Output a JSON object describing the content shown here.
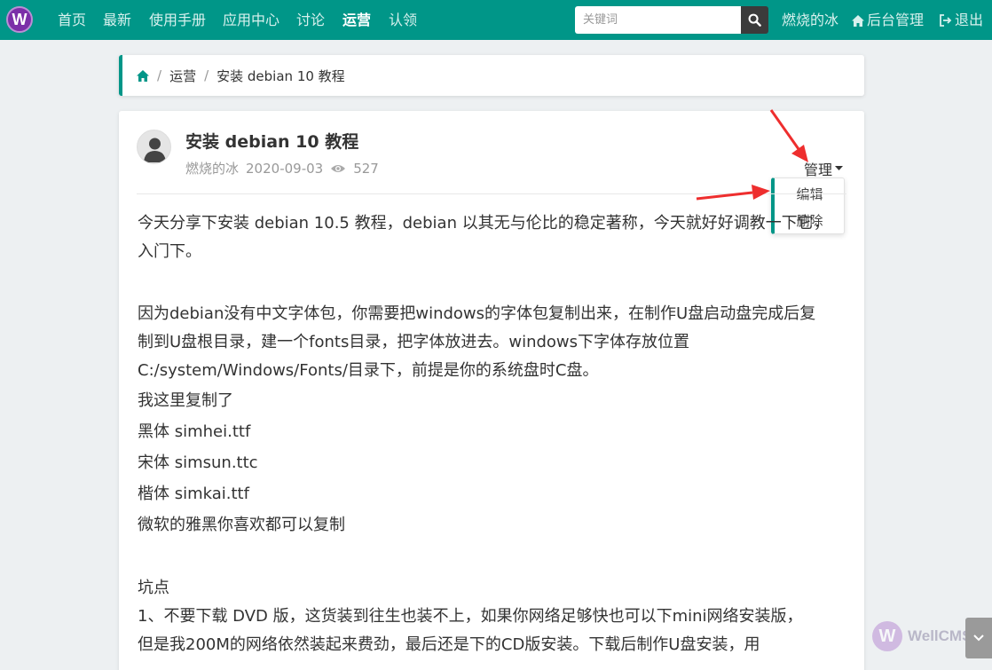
{
  "nav": {
    "logo": "W",
    "items": [
      "首页",
      "最新",
      "使用手册",
      "应用中心",
      "讨论",
      "运营",
      "认领"
    ],
    "active_index": 5,
    "search_placeholder": "关键词",
    "user": "燃烧的冰",
    "admin": "后台管理",
    "logout": "退出"
  },
  "breadcrumb": {
    "section": "运营",
    "current": "安装 debian 10 教程",
    "separator": "/"
  },
  "post": {
    "title": "安装 debian 10 教程",
    "author": "燃烧的冰",
    "date": "2020-09-03",
    "views": "527",
    "manage_label": "管理",
    "menu": [
      "编辑",
      "删除"
    ],
    "paragraphs": {
      "p1": "今天分享下安装 debian 10.5 教程，debian 以其无与伦比的稳定著称，今天就好好调教一下它，",
      "p1b": "入门下。",
      "p2": "因为debian没有中文字体包，你需要把windows的字体包复制出来，在制作U盘启动盘完成后复",
      "p2b": "制到U盘根目录，建一个fonts目录，把字体放进去。windows下字体存放位置",
      "p2c": "C:/system/Windows/Fonts/目录下，前提是你的系统盘时C盘。",
      "p3": "我这里复制了",
      "p4": "黑体 simhei.ttf",
      "p5": "宋体 simsun.ttc",
      "p6": "楷体 simkai.ttf",
      "p7": "微软的雅黑你喜欢都可以复制",
      "p8": "坑点",
      "p9": "1、不要下载 DVD 版，这货装到往生也装不上，如果你网络足够快也可以下mini网络安装版，",
      "p9b": "但是我200M的网络依然装起来费劲，最后还是下的CD版安装。下载后制作U盘安装，用"
    }
  },
  "watermark": {
    "logo": "W",
    "text": "WellCMS"
  },
  "colors": {
    "brand": "#009688",
    "logo": "#7b2fa8",
    "arrow": "#ee2e2e"
  }
}
